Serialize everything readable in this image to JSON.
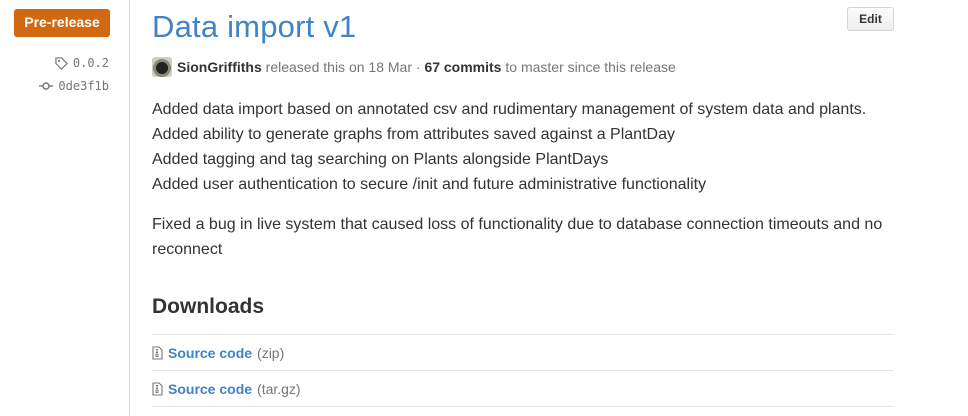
{
  "release": {
    "badge": "Pre-release",
    "tag": "0.0.2",
    "commit": "0de3f1b",
    "title": "Data import v1",
    "edit_label": "Edit",
    "author": "SionGriffiths",
    "released_text": "released this on 18 Mar",
    "separator": "·",
    "commits_count": "67 commits",
    "commits_suffix": "to master since this release"
  },
  "notes": {
    "lines": [
      "Added data import based on annotated csv and rudimentary management of system data and plants.",
      "Added ability to generate graphs from attributes saved against a PlantDay",
      "Added tagging and tag searching on Plants alongside PlantDays",
      "Added user authentication to secure /init and future administrative functionality"
    ],
    "fix": "Fixed a bug in live system that caused loss of functionality due to database connection timeouts and no reconnect"
  },
  "downloads": {
    "heading": "Downloads",
    "items": [
      {
        "label": "Source code",
        "format": "(zip)"
      },
      {
        "label": "Source code",
        "format": "(tar.gz)"
      }
    ]
  },
  "icons": {
    "tag": "tag-icon",
    "commit": "git-commit-icon",
    "file": "file-zip-icon"
  },
  "colors": {
    "badge": "#d26911",
    "link": "#4183c4",
    "muted": "#767676"
  }
}
